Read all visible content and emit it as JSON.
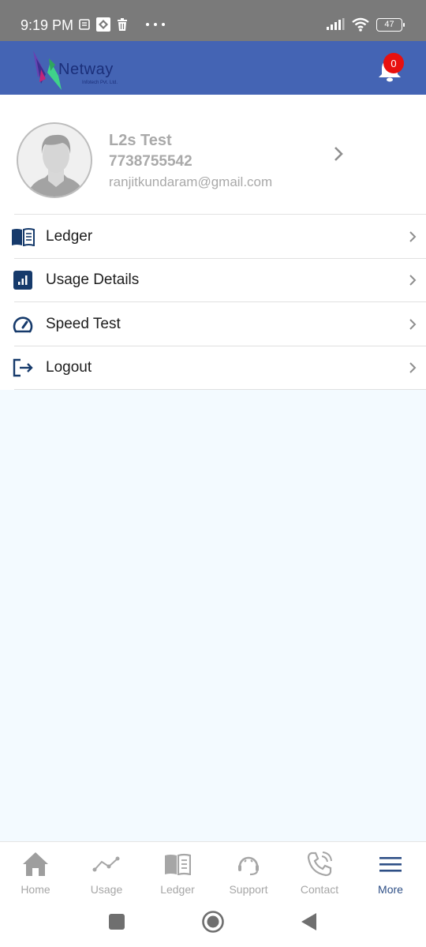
{
  "status_bar": {
    "time": "9:19 PM",
    "battery": "47",
    "left_icons": [
      "notes-icon",
      "app-icon",
      "trash-icon",
      "more-dots-icon"
    ],
    "right_icons": [
      "signal-icon",
      "wifi-icon",
      "battery-icon"
    ]
  },
  "header": {
    "logo_text": "Netway",
    "logo_subtext": "Infotech Pvt. Ltd.",
    "notification_count": "0",
    "brand_color": "#4464b4"
  },
  "profile": {
    "name": "L2s Test",
    "phone": "7738755542",
    "email": "ranjitkundaram@gmail.com"
  },
  "menu": {
    "items": [
      {
        "label": "Ledger",
        "icon": "ledger-book-icon"
      },
      {
        "label": "Usage Details",
        "icon": "bar-chart-icon"
      },
      {
        "label": "Speed Test",
        "icon": "speedometer-icon"
      },
      {
        "label": "Logout",
        "icon": "logout-icon"
      }
    ]
  },
  "bottom_nav": {
    "items": [
      {
        "label": "Home",
        "icon": "home-icon",
        "active": false
      },
      {
        "label": "Usage",
        "icon": "line-chart-icon",
        "active": false
      },
      {
        "label": "Ledger",
        "icon": "book-icon",
        "active": false
      },
      {
        "label": "Support",
        "icon": "headset-icon",
        "active": false
      },
      {
        "label": "Contact",
        "icon": "phone-icon",
        "active": false
      },
      {
        "label": "More",
        "icon": "menu-icon",
        "active": true
      }
    ],
    "active_color": "#2e4f86",
    "inactive_color": "#a6a6a6"
  }
}
